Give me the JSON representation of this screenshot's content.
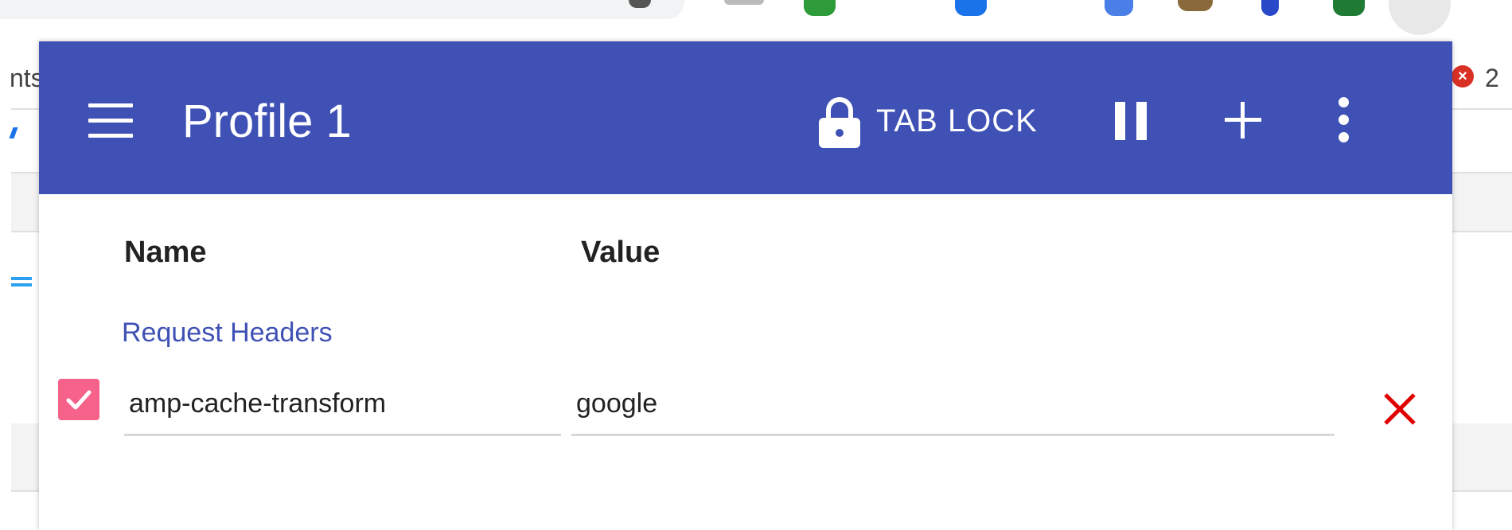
{
  "background": {
    "left_fragment": "nts",
    "error_count": "2"
  },
  "popup": {
    "toolbar": {
      "title": "Profile 1",
      "tab_lock_label": "TAB LOCK",
      "accent_color": "#3f51b5"
    },
    "columns": {
      "name": "Name",
      "value": "Value"
    },
    "section_title": "Request Headers",
    "headers": [
      {
        "enabled": true,
        "name": "amp-cache-transform",
        "value": "google"
      }
    ],
    "colors": {
      "checkbox": "#f7628b",
      "delete": "#e00000"
    },
    "icons": {
      "menu": "menu-icon",
      "lock": "lock-icon",
      "pause": "pause-icon",
      "add": "plus-icon",
      "more": "more-vert-icon",
      "check": "check-icon",
      "delete": "close-icon"
    }
  }
}
